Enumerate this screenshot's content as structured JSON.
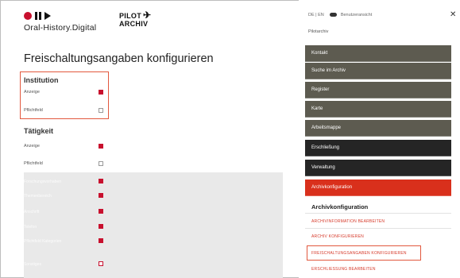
{
  "header": {
    "logo_text": "Oral-History.Digital",
    "pilot_line1": "PILOT",
    "pilot_line2": "ARCHIV",
    "plane_glyph": "✈"
  },
  "main": {
    "title": "Freischaltungsangaben konfigurieren",
    "sections": [
      {
        "title": "Institution",
        "rows": [
          {
            "label": "Anzeige",
            "checked": true
          },
          {
            "label": "Pflichtfeld",
            "checked": false
          }
        ]
      },
      {
        "title": "Tätigkeit",
        "rows": [
          {
            "label": "Anzeige",
            "checked": true
          },
          {
            "label": "Pflichtfeld",
            "checked": false
          }
        ]
      }
    ],
    "grey_rows": [
      {
        "label": "Forschungsvorhaben",
        "checked": true
      },
      {
        "label": "Themenbereich",
        "checked": true
      },
      {
        "label": "Anschrift",
        "checked": true
      },
      {
        "label": "Telefon",
        "checked": true
      },
      {
        "label": "Pflichtfeld Kategorien",
        "checked": true
      },
      {
        "label": "Sonstiges",
        "checked": false
      }
    ]
  },
  "sidebar": {
    "lang": "DE | EN",
    "toggle_label": "Benutzeransicht",
    "sub_label": "Pilotarchiv",
    "close_glyph": "✕",
    "nav": [
      {
        "label": "Kontakt",
        "style": "olive"
      },
      {
        "label": "Suche im Archiv",
        "style": "olive"
      },
      {
        "label": "Register",
        "style": "olive"
      },
      {
        "label": "Karte",
        "style": "olive"
      },
      {
        "label": "Arbeitsmappe",
        "style": "olive"
      },
      {
        "label": "Erschließung",
        "style": "dark"
      },
      {
        "label": "Verwaltung",
        "style": "dark"
      },
      {
        "label": "Archivkonfiguration",
        "style": "red"
      }
    ],
    "config_heading": "Archivkonfiguration",
    "config_links": [
      "ARCHIVINFORMATION BEARBEITEN",
      "ARCHIV KONFIGURIEREN",
      "FREISCHALTUNGSANGABEN KONFIGURIEREN",
      "ERSCHLIESSUNG BEARBEITEN"
    ]
  },
  "colors": {
    "accent": "#d9301c",
    "olive": "#5d5b50",
    "dark": "#252525",
    "highlight": "#e2583e"
  }
}
